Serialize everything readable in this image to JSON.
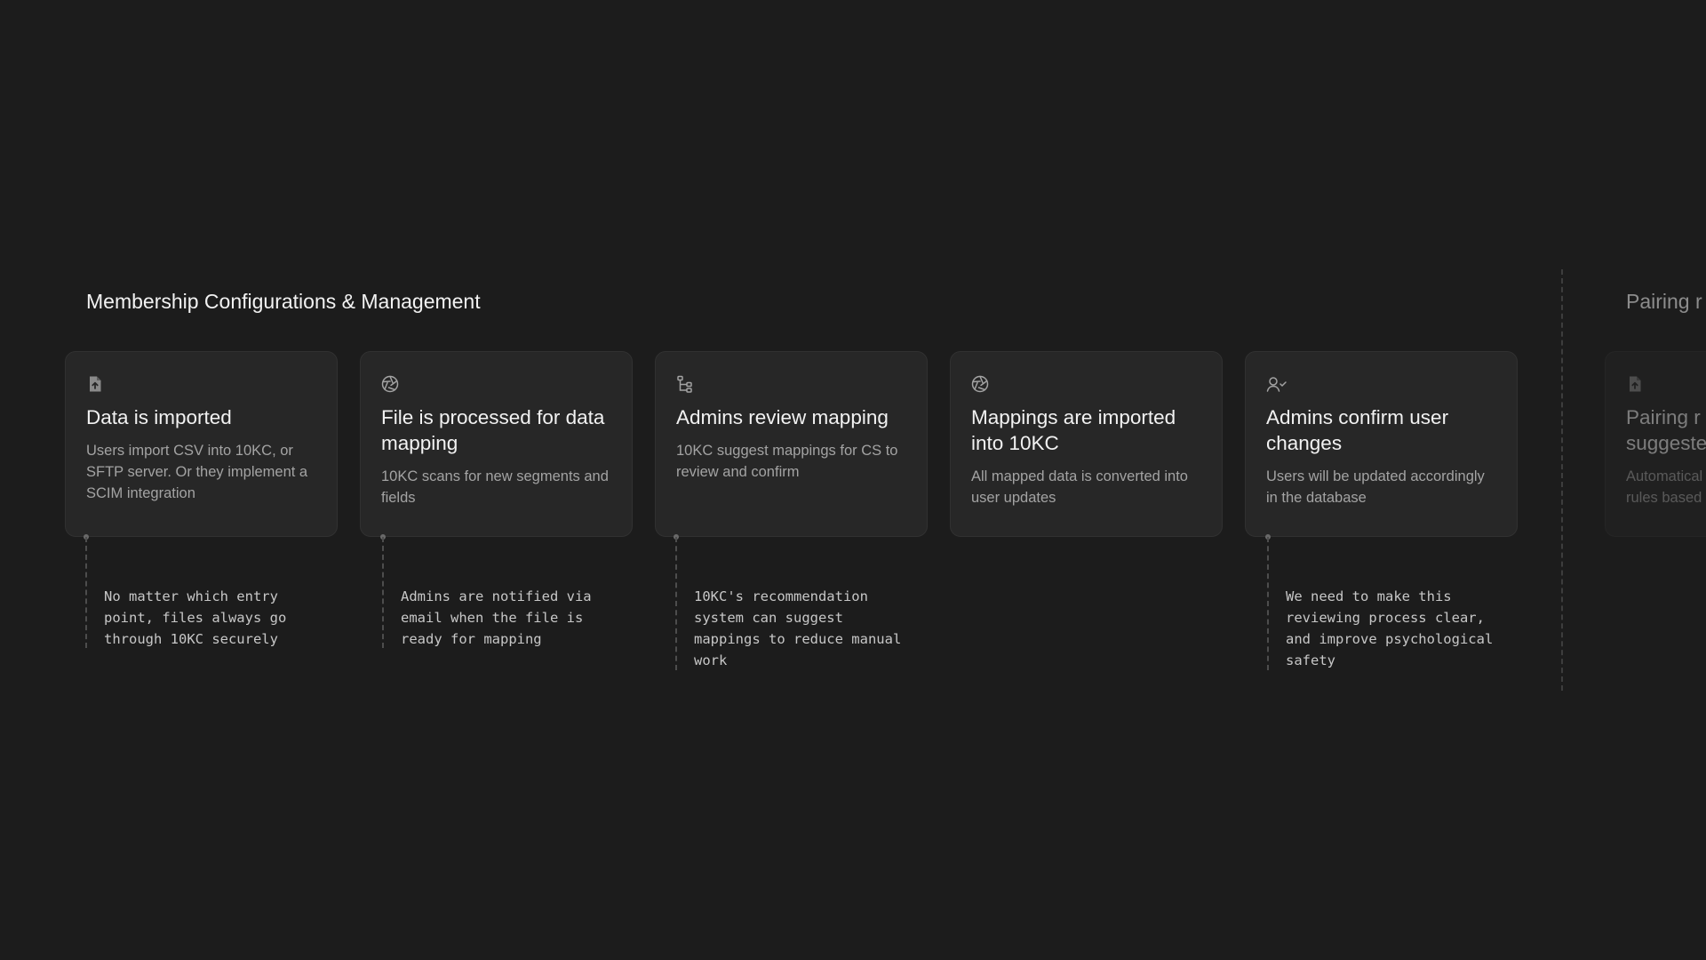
{
  "section": {
    "title": "Membership Configurations & Management",
    "next_title": "Pairing r"
  },
  "cards": [
    {
      "icon": "file-upload-icon",
      "title": "Data is imported",
      "description": "Users import CSV into 10KC, or SFTP server. Or they implement a SCIM integration"
    },
    {
      "icon": "aperture-icon",
      "title": "File is processed for data mapping",
      "description": "10KC scans for new segments and fields"
    },
    {
      "icon": "tree-structure-icon",
      "title": "Admins review mapping",
      "description": "10KC suggest mappings for CS to review and confirm"
    },
    {
      "icon": "aperture-icon",
      "title": "Mappings are imported into 10KC",
      "description": "All mapped data is converted into user updates"
    },
    {
      "icon": "user-check-icon",
      "title": "Admins confirm user changes",
      "description": "Users will be updated accordingly in the database"
    },
    {
      "icon": "file-upload-icon",
      "title": "Pairing r\nsuggeste",
      "description": "Automatical\nrules based"
    }
  ],
  "notes": [
    {
      "card": 1,
      "text": "No matter which entry\npoint, files always go\nthrough 10KC securely"
    },
    {
      "card": 2,
      "text": "Admins are notified via\nemail when the file is\nready for mapping"
    },
    {
      "card": 3,
      "text": "10KC's recommendation\nsystem can suggest\nmappings to reduce manual\nwork"
    },
    {
      "card": 5,
      "text": "We need to make this\nreviewing process clear,\nand improve psychological\nsafety"
    }
  ]
}
